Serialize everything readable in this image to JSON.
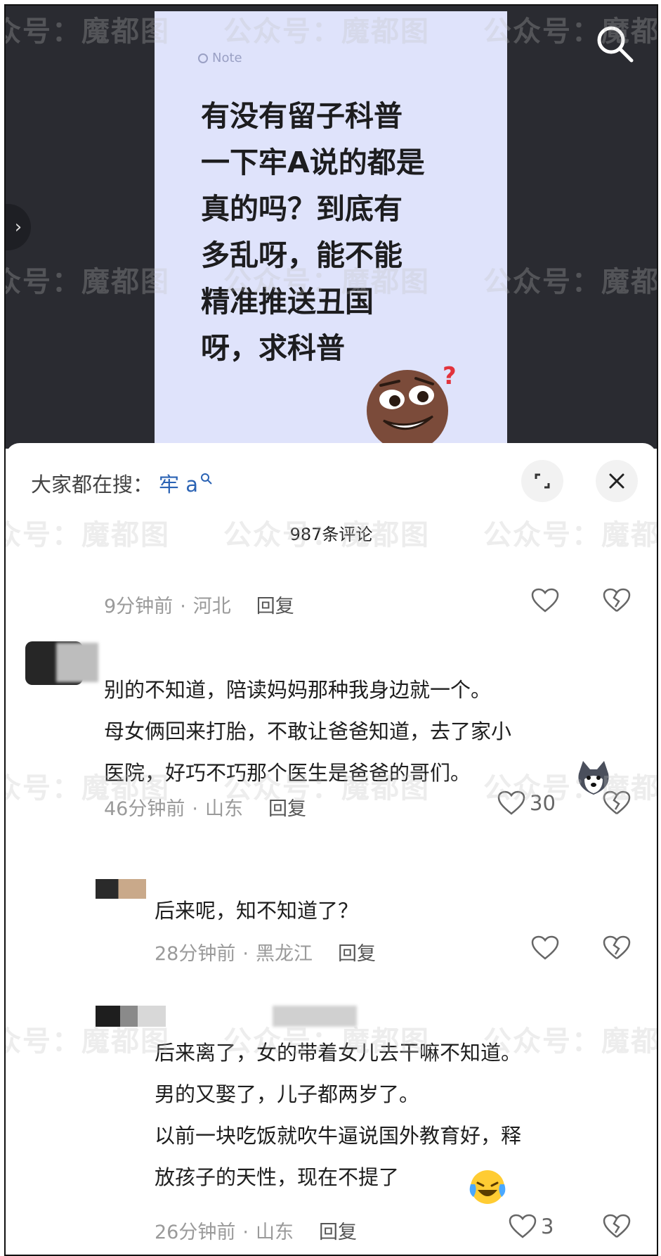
{
  "note": {
    "tag": "Note",
    "lines": [
      "有没有留子科普",
      "一下牢A说的都是",
      "真的吗？到底有",
      "多乱呀，能不能",
      "精准推送丑国",
      "呀，求科普"
    ]
  },
  "search": {
    "prefix": "大家都在搜：",
    "keyword": "牢 a"
  },
  "comment_count": "987条评论",
  "comments": [
    {
      "time": "9分钟前",
      "location": "河北",
      "reply": "回复",
      "likes": ""
    },
    {
      "lines": [
        "别的不知道，陪读妈妈那种我身边就一个。",
        "母女俩回来打胎，不敢让爸爸知道，去了家小",
        "医院，好巧不巧那个医生是爸爸的哥们。"
      ],
      "time": "46分钟前",
      "location": "山东",
      "reply": "回复",
      "likes": "30"
    },
    {
      "lines": [
        "后来呢，知不知道了？"
      ],
      "time": "28分钟前",
      "location": "黑龙江",
      "reply": "回复",
      "likes": ""
    },
    {
      "lines": [
        "后来离了，女的带着女儿去干嘛不知道。",
        "男的又娶了，儿子都两岁了。",
        "以前一块吃饭就吹牛逼说国外教育好，释",
        "放孩子的天性，现在不提了"
      ],
      "time": "26分钟前",
      "location": "山东",
      "reply": "回复",
      "likes": "3"
    }
  ],
  "watermark": "公众号：魔都图"
}
